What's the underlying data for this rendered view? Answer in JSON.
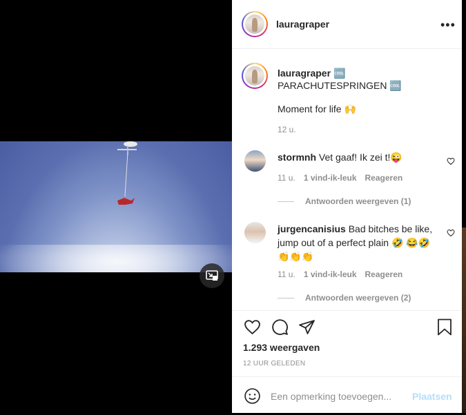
{
  "post": {
    "username": "lauragraper",
    "caption_title": "🆒 PARACHUTESPRINGEN 🆒",
    "caption_body": "Moment for life 🙌",
    "caption_time": "12 u."
  },
  "comments": [
    {
      "username": "stormnh",
      "text": "Vet gaaf! Ik zei t!😜",
      "time": "11 u.",
      "likes": "1 vind-ik-leuk",
      "reply_label": "Reageren",
      "view_replies": "Antwoorden weergeven (1)"
    },
    {
      "username": "jurgencanisius",
      "text": "Bad bitches be like, jump out of a perfect plain 🤣 😂🤣👏👏👏",
      "time": "11 u.",
      "likes": "1 vind-ik-leuk",
      "reply_label": "Reageren",
      "view_replies": "Antwoorden weergeven (2)"
    }
  ],
  "stats": {
    "views": "1.293 weergaven",
    "posted": "12 UUR GELEDEN"
  },
  "comment_box": {
    "placeholder": "Een opmerking toevoegen...",
    "post_label": "Plaatsen"
  },
  "icons": {
    "pip": "picture-in-picture-icon",
    "more": "more-options-icon",
    "like": "heart-icon",
    "comment": "comment-icon",
    "share": "paper-plane-icon",
    "save": "bookmark-icon",
    "emoji": "smiley-icon"
  },
  "colors": {
    "post_button": "#b2dffc",
    "meta_text": "#8e8e8e"
  }
}
